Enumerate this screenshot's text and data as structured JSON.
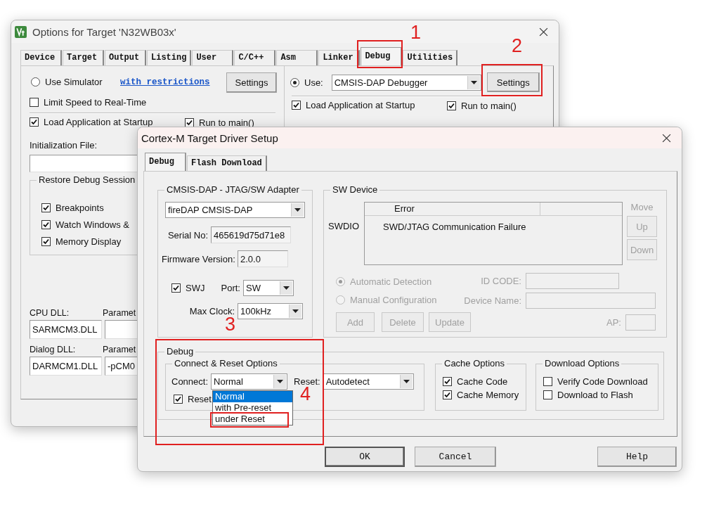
{
  "options_window": {
    "title": "Options for Target 'N32WB03x'",
    "tabs": [
      {
        "label": "Device",
        "selected": false
      },
      {
        "label": "Target",
        "selected": false
      },
      {
        "label": "Output",
        "selected": false
      },
      {
        "label": "Listing",
        "selected": false
      },
      {
        "label": "User",
        "selected": false
      },
      {
        "label": "C/C++",
        "selected": false
      },
      {
        "label": "Asm",
        "selected": false
      },
      {
        "label": "Linker",
        "selected": false
      },
      {
        "label": "Debug",
        "selected": true
      },
      {
        "label": "Utilities",
        "selected": false
      }
    ],
    "simulator": {
      "mode": {
        "label": "Use Simulator",
        "selected": false
      },
      "link": "with restrictions",
      "settings_button": "Settings",
      "limit_speed": {
        "label": "Limit Speed to Real-Time",
        "checked": false
      },
      "load_application": {
        "label": "Load Application at Startup",
        "checked": true
      },
      "run_to_main": {
        "label": "Run to main()",
        "checked": true
      },
      "init_file_label": "Initialization File:",
      "restore_session": {
        "title": "Restore Debug Session",
        "items": [
          {
            "label": "Breakpoints",
            "checked": true
          },
          {
            "label": "Watch Windows &",
            "checked": true
          },
          {
            "label": "Memory Display",
            "checked": true
          }
        ]
      },
      "cpu_dll": {
        "label": "CPU DLL:",
        "parameter_label": "Paramet",
        "value": "SARMCM3.DLL"
      },
      "dialog_dll": {
        "label": "Dialog DLL:",
        "parameter_label": "Paramet",
        "value": "DARMCM1.DLL",
        "parameter": "-pCM0"
      }
    },
    "debugger": {
      "mode": {
        "label": "Use:",
        "selected": true
      },
      "driver": "CMSIS-DAP Debugger",
      "settings_button": "Settings",
      "load_application": {
        "label": "Load Application at Startup",
        "checked": true
      },
      "run_to_main": {
        "label": "Run to main()",
        "checked": true
      }
    }
  },
  "driver_setup": {
    "title": "Cortex-M Target Driver Setup",
    "tabs": [
      {
        "label": "Debug",
        "selected": true
      },
      {
        "label": "Flash Download",
        "selected": false
      }
    ],
    "adapter": {
      "title": "CMSIS-DAP - JTAG/SW Adapter",
      "device": "fireDAP CMSIS-DAP",
      "serial_label": "Serial No:",
      "serial": "465619d75d71e8",
      "firmware_label": "Firmware Version:",
      "firmware": "2.0.0",
      "swj": {
        "label": "SWJ",
        "checked": true
      },
      "port_label": "Port:",
      "port": "SW",
      "clock_label": "Max Clock:",
      "clock": "100kHz"
    },
    "sw_device": {
      "title": "SW Device",
      "row_label": "SWDIO",
      "table": {
        "column_1": "Error",
        "row": "SWD/JTAG Communication Failure"
      },
      "move_label": "Move",
      "move_buttons": [
        {
          "label": "Up",
          "disabled": true
        },
        {
          "label": "Down",
          "disabled": true
        }
      ],
      "detection": [
        {
          "label": "Automatic Detection",
          "selected": true,
          "disabled": true
        },
        {
          "label": "Manual Configuration",
          "selected": false,
          "disabled": true
        }
      ],
      "id_code_label": "ID CODE:",
      "device_name_label": "Device Name:",
      "ap_label": "AP:",
      "buttons": [
        {
          "label": "Add",
          "disabled": true
        },
        {
          "label": "Delete",
          "disabled": true
        },
        {
          "label": "Update",
          "disabled": true
        }
      ]
    },
    "debug": {
      "title": "Debug",
      "connect_reset": {
        "title": "Connect & Reset Options",
        "connect_label": "Connect:",
        "connect": "Normal",
        "reset_label": "Reset:",
        "reset": "Autodetect",
        "reset_after_connect": {
          "label": "Reset",
          "checked": true
        },
        "connect_options": [
          {
            "label": "Normal",
            "selected": true
          },
          {
            "label": "with Pre-reset",
            "selected": false
          },
          {
            "label": "under Reset",
            "selected": false
          }
        ]
      },
      "cache": {
        "title": "Cache Options",
        "items": [
          {
            "label": "Cache Code",
            "checked": true
          },
          {
            "label": "Cache Memory",
            "checked": true
          }
        ]
      },
      "download": {
        "title": "Download Options",
        "items": [
          {
            "label": "Verify Code Download",
            "checked": false
          },
          {
            "label": "Download to Flash",
            "checked": false
          }
        ]
      }
    },
    "buttons": [
      {
        "label": "OK"
      },
      {
        "label": "Cancel"
      },
      {
        "label": "Help"
      }
    ]
  },
  "annotations": [
    {
      "label": "1"
    },
    {
      "label": "2"
    },
    {
      "label": "3"
    },
    {
      "label": "4"
    }
  ]
}
